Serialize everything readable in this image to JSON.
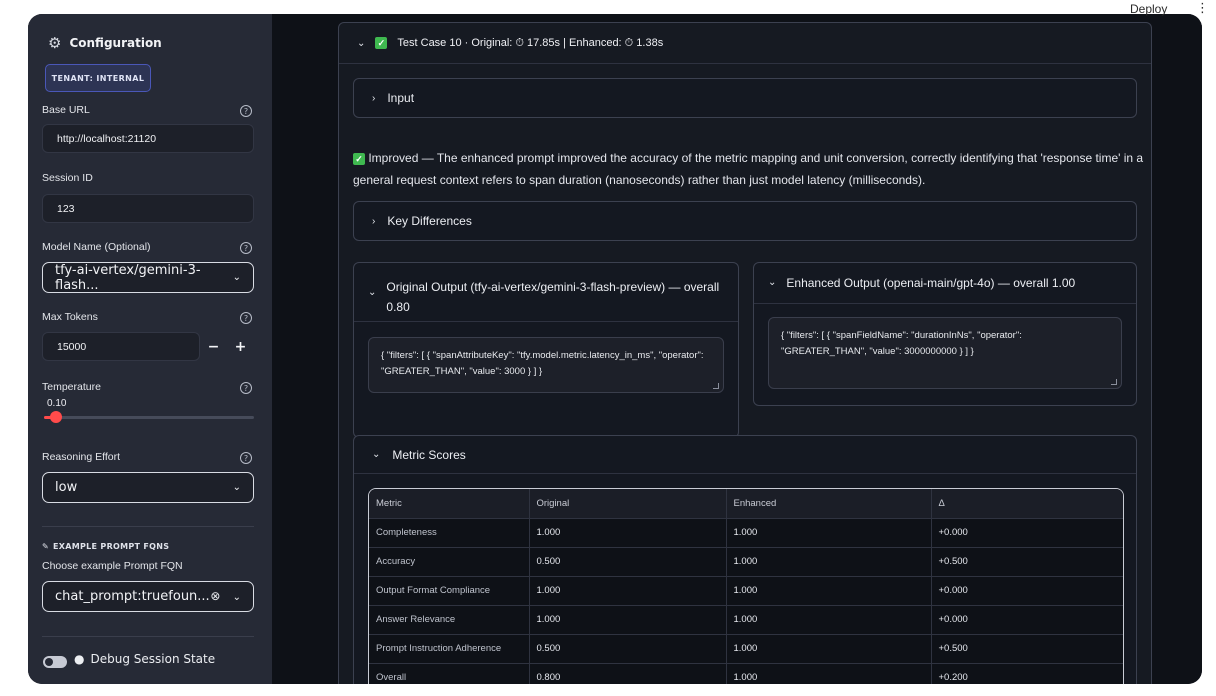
{
  "topbar": {
    "deploy_label": "Deploy",
    "menu_glyph": "⋮"
  },
  "sidebar": {
    "title": "Configuration",
    "title_icon": "gear-icon",
    "tenant_button": "TENANT: INTERNAL",
    "base_url": {
      "label": "Base URL",
      "value": "http://localhost:21120"
    },
    "session_id": {
      "label": "Session ID",
      "value": "123"
    },
    "model_name": {
      "label": "Model Name (Optional)",
      "value": "tfy-ai-vertex/gemini-3-flash..."
    },
    "max_tokens": {
      "label": "Max Tokens",
      "value": "15000",
      "minus": "−",
      "plus": "+"
    },
    "temperature": {
      "label": "Temperature",
      "value": "0.10",
      "fraction": 0.05
    },
    "reasoning_effort": {
      "label": "Reasoning Effort",
      "value": "low"
    },
    "example_prompts": {
      "heading": "EXAMPLE PROMPT FQNS",
      "label": "Choose example Prompt FQN",
      "value": "chat_prompt:truefoun..."
    },
    "debug": {
      "label": "Debug Session State",
      "toggled": false
    }
  },
  "main": {
    "test_case_header": "Test Case 10 · Original: ⏱ 17.85s | Enhanced: ⏱ 1.38s",
    "input_expander": "Input",
    "improved_text": "Improved — The enhanced prompt improved the accuracy of the metric mapping and unit conversion, correctly identifying that 'response time' in a general request context refers to span duration (nanoseconds) rather than just model latency (milliseconds).",
    "key_differences_expander": "Key Differences",
    "original_output": {
      "title": "Original Output (tfy-ai-vertex/gemini-3-flash-preview) — overall 0.80",
      "code": "{ \"filters\": [ { \"spanAttributeKey\": \"tfy.model.metric.latency_in_ms\", \"operator\": \"GREATER_THAN\", \"value\": 3000 } ] }"
    },
    "enhanced_output": {
      "title": "Enhanced Output (openai-main/gpt-4o) — overall 1.00",
      "code": "{ \"filters\": [ { \"spanFieldName\": \"durationInNs\", \"operator\": \"GREATER_THAN\", \"value\": 3000000000 } ] }"
    },
    "metric_scores": {
      "title": "Metric Scores",
      "columns": [
        "Metric",
        "Original",
        "Enhanced",
        "Δ"
      ],
      "rows": [
        [
          "Completeness",
          "1.000",
          "1.000",
          "+0.000"
        ],
        [
          "Accuracy",
          "0.500",
          "1.000",
          "+0.500"
        ],
        [
          "Output Format Compliance",
          "1.000",
          "1.000",
          "+0.000"
        ],
        [
          "Answer Relevance",
          "1.000",
          "1.000",
          "+0.000"
        ],
        [
          "Prompt Instruction Adherence",
          "0.500",
          "1.000",
          "+0.500"
        ],
        [
          "Overall",
          "0.800",
          "1.000",
          "+0.200"
        ]
      ]
    }
  },
  "colors": {
    "accent_red": "#ff4b4b",
    "check_green": "#3fb950",
    "tenant_blue": "#4a57b8"
  }
}
